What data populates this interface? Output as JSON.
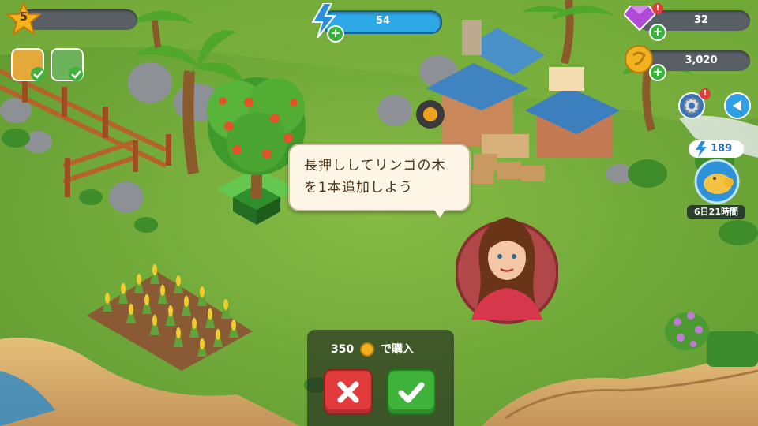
{
  "hud": {
    "level": "5",
    "energy": "54",
    "gems": "32",
    "coins": "3,020",
    "boost_energy": "189",
    "piggy_timer": "6日21時間"
  },
  "dialog": {
    "hint_text": "長押ししてリンゴの木を1本追加しよう"
  },
  "purchase": {
    "price": "350",
    "price_suffix": "で購入"
  },
  "icons": {
    "level": "star-icon",
    "energy": "lightning-icon",
    "gems": "gem-icon",
    "coins": "coin-icon",
    "settings": "gear-icon",
    "back": "play-left-icon",
    "piggy": "piggy-bank-icon",
    "cancel": "cross-icon",
    "confirm": "checkmark-icon"
  },
  "colors": {
    "confirm_button": "#3fb23a",
    "cancel_button": "#e23b3b",
    "energy_bar": "#2fa8e8"
  }
}
